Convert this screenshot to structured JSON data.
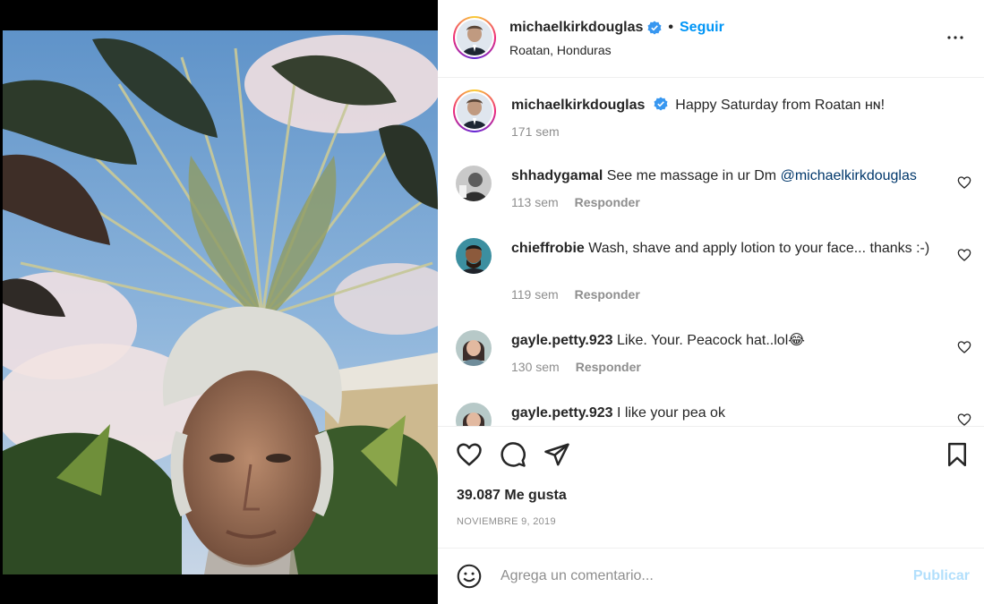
{
  "post": {
    "username": "michaelkirkdouglas",
    "follow_label": "Seguir",
    "separator": "•",
    "location": "Roatan, Honduras",
    "more_icon": "more-horizontal-icon",
    "verified_icon": "verified-badge-icon"
  },
  "caption": {
    "username": "michaelkirkdouglas",
    "text": "Happy Saturday from Roatan ʜɴ!",
    "time": "171 sem"
  },
  "comments": [
    {
      "username": "shhadygamal",
      "text": "See me massage in ur Dm ",
      "mention": "@michaelkirkdouglas",
      "time": "113 sem",
      "reply": "Responder"
    },
    {
      "username": "chieffrobie",
      "text": "Wash, shave and apply lotion to your face... thanks :-)",
      "mention": "",
      "time": "119 sem",
      "reply": "Responder"
    },
    {
      "username": "gayle.petty.923",
      "text": "Like. Your. Peacock hat..lol😂",
      "mention": "",
      "time": "130 sem",
      "reply": "Responder"
    },
    {
      "username": "gayle.petty.923",
      "text": "I like your pea ok",
      "mention": "",
      "time": "",
      "reply": ""
    }
  ],
  "actions": {
    "like_icon": "heart-icon",
    "comment_icon": "comment-bubble-icon",
    "share_icon": "paper-plane-icon",
    "save_icon": "bookmark-icon"
  },
  "likes_text": "39.087 Me gusta",
  "date": "NOVIEMBRE 9, 2019",
  "add_comment": {
    "placeholder": "Agrega un comentario...",
    "post_label": "Publicar",
    "emoji_icon": "smiley-emoji-icon"
  },
  "colors": {
    "link_blue": "#0095f6",
    "mention_blue": "#00376b",
    "muted": "#8e8e8e",
    "publish_disabled": "#b2dffc"
  }
}
